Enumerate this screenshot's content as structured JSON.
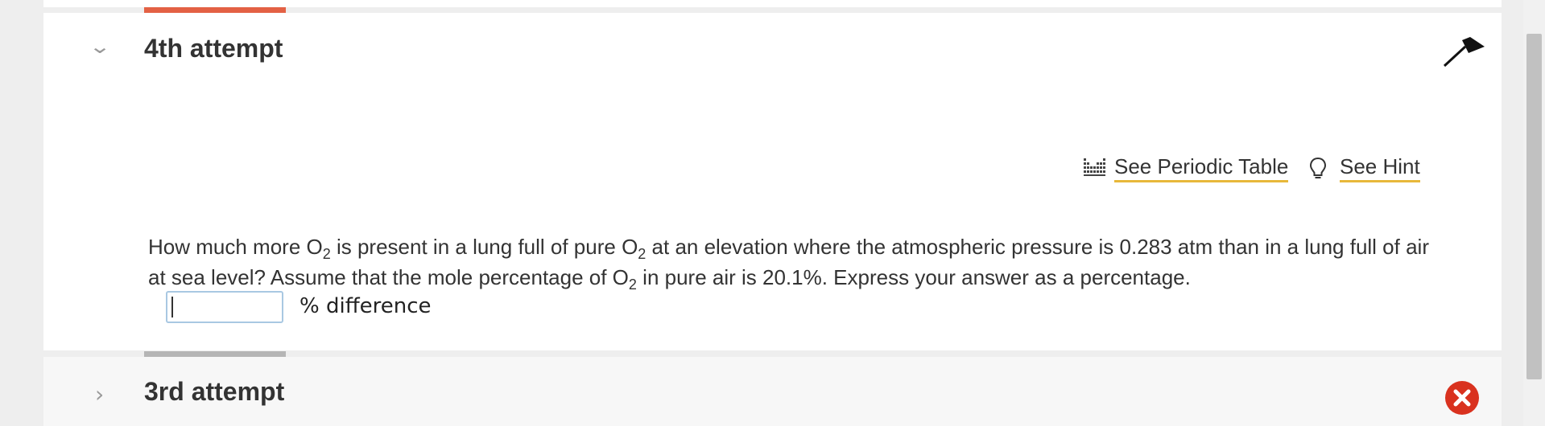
{
  "attempts": {
    "current": {
      "title": "4th attempt",
      "accent_color": "#e36144",
      "tools": {
        "periodic_table_label": "See Periodic Table",
        "hint_label": "See Hint"
      },
      "question": {
        "part1": "How much more O",
        "sub1": "2",
        "part2": " is present in a lung full of pure O",
        "sub2": "2",
        "part3": " at an elevation where the atmospheric pressure is 0.283 atm than in a lung full of air at sea level? Assume that the mole percentage of O",
        "sub3": "2",
        "part4": " in pure air is 20.1%. Express your answer as a percentage."
      },
      "answer": {
        "value": "",
        "placeholder": "",
        "unit": "% difference"
      },
      "icons": {
        "collapse": "chevron-down-icon",
        "flag": "flag-icon",
        "periodic": "periodic-table-icon",
        "hint": "lightbulb-icon"
      }
    },
    "previous": {
      "title": "3rd attempt",
      "status_color": "#d9321f",
      "icons": {
        "expand": "chevron-right-icon",
        "status": "incorrect-x-icon"
      }
    }
  },
  "colors": {
    "link_underline": "#e8b83a",
    "input_border": "#a9c8e2"
  }
}
